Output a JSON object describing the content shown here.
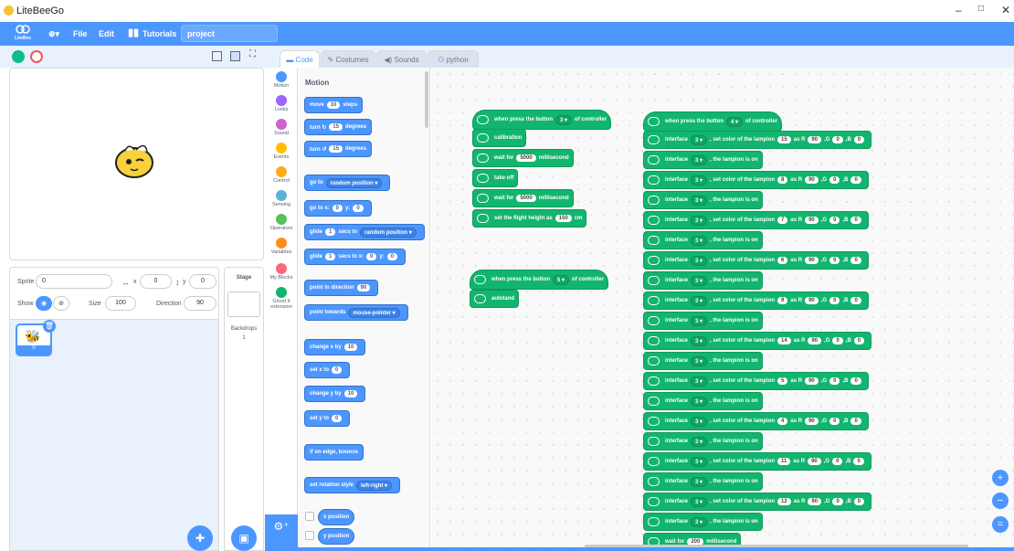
{
  "window": {
    "title": "LiteBeeGo",
    "minimize": "–",
    "maximize": "□",
    "close": "✕"
  },
  "menu": {
    "logo_text": "LiteBee",
    "globe": "⊕▾",
    "file": "File",
    "edit": "Edit",
    "tutorials": "Tutorials",
    "project_name": "project"
  },
  "tabs": [
    {
      "label": "Code"
    },
    {
      "label": "Costumes"
    },
    {
      "label": "Sounds"
    },
    {
      "label": "python"
    }
  ],
  "categories": [
    "Motion",
    "Looks",
    "Sound",
    "Events",
    "Control",
    "Sensing",
    "Operators",
    "Variables",
    "My Blocks",
    "Ghost II extension"
  ],
  "category_colors": [
    "#4c97ff",
    "#9966ff",
    "#cf63cf",
    "#ffbf00",
    "#ffab19",
    "#5cb1d6",
    "#59c059",
    "#ff8c1a",
    "#ff6680",
    "#12b56e"
  ],
  "palette": {
    "heading": "Motion",
    "move": {
      "pre": "move",
      "val": "10",
      "post": "steps"
    },
    "turn_right": {
      "pre": "turn ↻",
      "val": "15",
      "post": "degrees"
    },
    "turn_left": {
      "pre": "turn ↺",
      "val": "15",
      "post": "degrees"
    },
    "goto": {
      "pre": "go to",
      "dd": "random position ▾"
    },
    "gotoxy": {
      "pre": "go to x:",
      "x": "0",
      "mid": "y:",
      "y": "0"
    },
    "glide_to": {
      "pre": "glide",
      "val": "1",
      "mid": "secs to",
      "dd": "random position ▾"
    },
    "glide_xy": {
      "pre": "glide",
      "val": "1",
      "mid": "secs to x:",
      "x": "0",
      "mid2": "y:",
      "y": "0"
    },
    "point_dir": {
      "pre": "point in direction",
      "val": "90"
    },
    "point_towards": {
      "pre": "point towards",
      "dd": "mouse-pointer ▾"
    },
    "change_x": {
      "pre": "change x by",
      "val": "10"
    },
    "set_x": {
      "pre": "set x to",
      "val": "0"
    },
    "change_y": {
      "pre": "change y by",
      "val": "10"
    },
    "set_y": {
      "pre": "set y to",
      "val": "0"
    },
    "bounce": "if on edge, bounce",
    "rotation": {
      "pre": "set rotation style",
      "dd": "left-right ▾"
    },
    "xpos": "x position",
    "ypos": "y position"
  },
  "sprite_info": {
    "sprite_label": "Sprite",
    "sprite_name": "0",
    "x_label": "x",
    "x_val": "0",
    "y_label": "y",
    "y_val": "0",
    "show_label": "Show",
    "size_label": "Size",
    "size_val": "100",
    "direction_label": "Direction",
    "direction_val": "90",
    "thumb_label": "0"
  },
  "stage_pane": {
    "label": "Stage",
    "backdrops_label": "Backdrops",
    "backdrops_count": "1"
  },
  "script1": {
    "hat": {
      "pre": "when press the button",
      "dd": "3 ▾",
      "post": "of controller"
    },
    "calibration": "calibration",
    "wait1": {
      "pre": "wait for",
      "val": "5000",
      "post": "millisecond"
    },
    "takeoff": "take off",
    "wait2": {
      "pre": "wait for",
      "val": "5000",
      "post": "millisecond"
    },
    "height": {
      "pre": "set the flight height as",
      "val": "150",
      "post": "cm"
    }
  },
  "script2": {
    "hat": {
      "pre": "when press the button",
      "dd": "5 ▾",
      "post": "of controller"
    },
    "autoland": "autoland"
  },
  "script3": {
    "hat": {
      "pre": "when press the button",
      "dd": "4 ▾",
      "post": "of controller"
    },
    "iface": "interface",
    "port": "3 ▾",
    "color_mid": ", set color of the lampion",
    "asR": "as R",
    "rval": "90",
    "g": ",G",
    "gval": "0",
    "b": ",B",
    "bval": "0",
    "on_text": ", the lampion is on",
    "lampions": [
      "15",
      "8",
      "7",
      "6",
      "9",
      "14",
      "5",
      "4",
      "11",
      "12"
    ],
    "wait": {
      "pre": "wait for",
      "val": "200",
      "post": "millisecond"
    }
  },
  "zoom": {
    "in": "+",
    "out": "−",
    "reset": "="
  }
}
